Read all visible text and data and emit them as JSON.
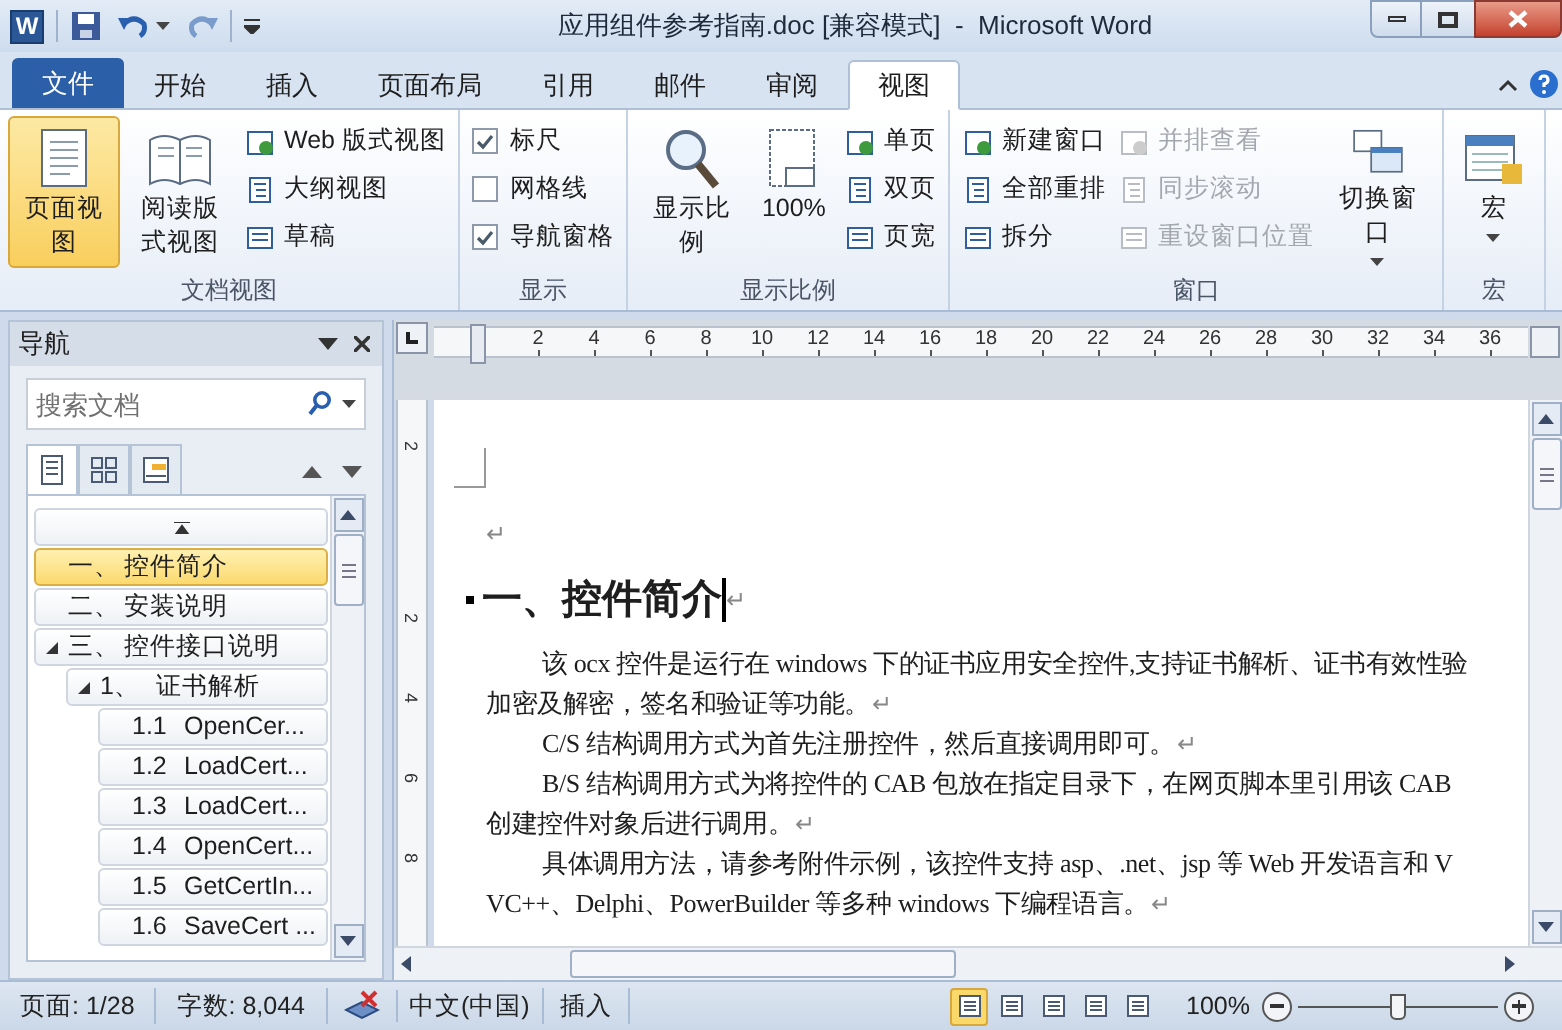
{
  "window": {
    "logo_letter": "W",
    "title": "应用组件参考指南.doc [兼容模式]  -  Microsoft Word"
  },
  "tabs": [
    {
      "label": "文件",
      "kind": "file",
      "selected": false
    },
    {
      "label": "开始",
      "kind": "tab",
      "selected": false
    },
    {
      "label": "插入",
      "kind": "tab",
      "selected": false
    },
    {
      "label": "页面布局",
      "kind": "tab",
      "selected": false
    },
    {
      "label": "引用",
      "kind": "tab",
      "selected": false
    },
    {
      "label": "邮件",
      "kind": "tab",
      "selected": false
    },
    {
      "label": "审阅",
      "kind": "tab",
      "selected": false
    },
    {
      "label": "视图",
      "kind": "tab",
      "selected": true
    }
  ],
  "ribbon": [
    {
      "label": "文档视图",
      "items": [
        {
          "kind": "large",
          "label": "页面视图",
          "selected": true
        },
        {
          "kind": "large",
          "label": "阅读版式视图",
          "selected": false
        },
        {
          "kind": "small",
          "label": "Web 版式视图",
          "disabled": false
        },
        {
          "kind": "small",
          "label": "大纲视图",
          "disabled": false
        },
        {
          "kind": "small",
          "label": "草稿",
          "disabled": false
        }
      ]
    },
    {
      "label": "显示",
      "items": [
        {
          "kind": "checkbox",
          "label": "标尺",
          "checked": true
        },
        {
          "kind": "checkbox",
          "label": "网格线",
          "checked": false
        },
        {
          "kind": "checkbox",
          "label": "导航窗格",
          "checked": true
        }
      ]
    },
    {
      "label": "显示比例",
      "items": [
        {
          "kind": "large",
          "label": "显示比例",
          "selected": false
        },
        {
          "kind": "large",
          "label": "100%",
          "selected": false
        },
        {
          "kind": "small",
          "label": "单页",
          "disabled": false
        },
        {
          "kind": "small",
          "label": "双页",
          "disabled": false
        },
        {
          "kind": "small",
          "label": "页宽",
          "disabled": false
        }
      ]
    },
    {
      "label": "窗口",
      "items": [
        {
          "kind": "small",
          "label": "新建窗口",
          "disabled": false
        },
        {
          "kind": "small",
          "label": "全部重排",
          "disabled": false
        },
        {
          "kind": "small",
          "label": "拆分",
          "disabled": false
        },
        {
          "kind": "small",
          "label": "并排查看",
          "disabled": true
        },
        {
          "kind": "small",
          "label": "同步滚动",
          "disabled": true
        },
        {
          "kind": "small",
          "label": "重设窗口位置",
          "disabled": true
        },
        {
          "kind": "menu",
          "label": "切换窗口",
          "selected": false
        }
      ]
    },
    {
      "label": "宏",
      "items": [
        {
          "kind": "menu",
          "label": "宏",
          "selected": false
        }
      ]
    }
  ],
  "navigation": {
    "title": "导航",
    "search": {
      "placeholder": "搜索文档"
    },
    "tabs": [
      {
        "selected": true
      },
      {
        "selected": false
      },
      {
        "selected": false
      }
    ],
    "items": [
      {
        "number": "一、",
        "title": "控件简介",
        "selected": true,
        "expanded": false
      },
      {
        "number": "二、",
        "title": "安装说明",
        "selected": false,
        "expanded": false
      },
      {
        "number": "三、",
        "title": "控件接口说明",
        "selected": false,
        "expanded": true,
        "children": [
          {
            "number": "1、",
            "title": "证书解析",
            "selected": false,
            "expanded": true,
            "children": [
              {
                "number": "1.1",
                "title": "OpenCer...",
                "selected": false,
                "expanded": false
              },
              {
                "number": "1.2",
                "title": "LoadCert...",
                "selected": false,
                "expanded": false
              },
              {
                "number": "1.3",
                "title": "LoadCert...",
                "selected": false,
                "expanded": false
              },
              {
                "number": "1.4",
                "title": "OpenCert...",
                "selected": false,
                "expanded": false
              },
              {
                "number": "1.5",
                "title": "GetCertIn...",
                "selected": false,
                "expanded": false
              },
              {
                "number": "1.6",
                "title": "SaveCert ...",
                "selected": false,
                "expanded": false
              }
            ]
          }
        ]
      }
    ]
  },
  "ruler": {
    "horizontal": [
      "2",
      "4",
      "6",
      "8",
      "10",
      "12",
      "14",
      "16",
      "18",
      "20",
      "22",
      "24",
      "26",
      "28",
      "30",
      "32",
      "34",
      "36"
    ],
    "vertical": [
      "2",
      "2",
      "4",
      "6",
      "8"
    ]
  },
  "document": {
    "blank_mark": "↵",
    "heading": {
      "text": "一、控件简介",
      "end_mark": "↵"
    },
    "lines": [
      {
        "text": "该 ocx 控件是运行在 windows 下的证书应用安全控件,支持证书解析、证书有效性验",
        "indent": true
      },
      {
        "text": "加密及解密，签名和验证等功能。",
        "indent": false,
        "end_mark": "↵"
      },
      {
        "text": "C/S 结构调用方式为首先注册控件，然后直接调用即可。",
        "indent": true,
        "end_mark": "↵"
      },
      {
        "text": "B/S 结构调用方式为将控件的 CAB 包放在指定目录下，在网页脚本里引用该 CAB",
        "indent": true
      },
      {
        "text": "创建控件对象后进行调用。",
        "indent": false,
        "end_mark": "↵"
      },
      {
        "text": "具体调用方法，请参考附件示例，该控件支持 asp、.net、jsp 等 Web 开发语言和 V",
        "indent": true
      },
      {
        "text": "VC++、Delphi、PowerBuilder 等多种 windows 下编程语言。",
        "indent": false,
        "end_mark": "↵"
      }
    ]
  },
  "status_bar": {
    "page": "页面: 1/28",
    "words": "字数: 8,044",
    "language": "中文(中国)",
    "mode": "插入",
    "views": [
      {
        "selected": true
      },
      {
        "selected": false
      },
      {
        "selected": false
      },
      {
        "selected": false
      },
      {
        "selected": false
      }
    ],
    "zoom": "100%",
    "zoom_slider": {
      "level": 0.5
    }
  }
}
